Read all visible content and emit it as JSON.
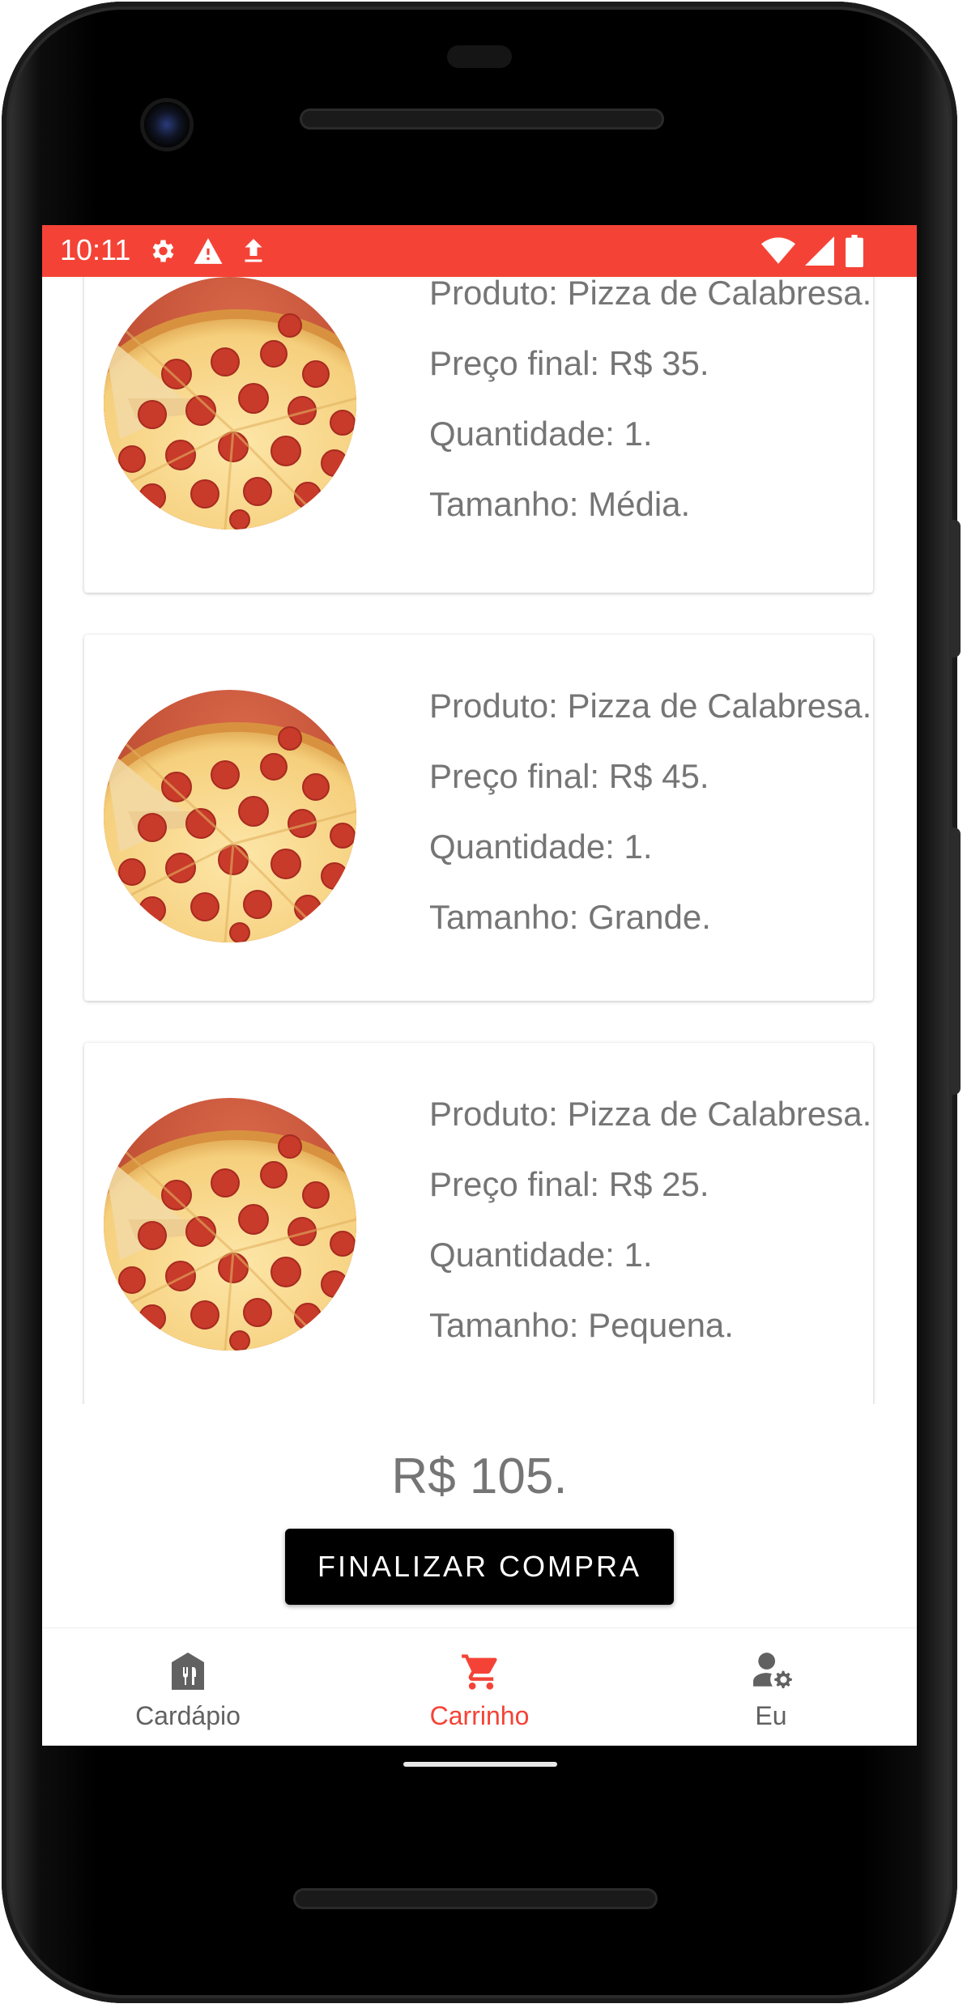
{
  "status_bar": {
    "time": "10:11",
    "icons_left": [
      "gear-icon",
      "warning-icon",
      "upload-icon"
    ],
    "icons_right": [
      "wifi-icon",
      "cell-signal-icon",
      "battery-icon"
    ],
    "color": "#f44336"
  },
  "cart": {
    "items": [
      {
        "product": "Produto: Pizza de Calabresa.",
        "price": "Preço final: R$ 35.",
        "quantity": "Quantidade: 1.",
        "size": "Tamanho: Média."
      },
      {
        "product": "Produto: Pizza de Calabresa.",
        "price": "Preço final: R$ 45.",
        "quantity": "Quantidade: 1.",
        "size": "Tamanho: Grande."
      },
      {
        "product": "Produto: Pizza de Calabresa.",
        "price": "Preço final: R$ 25.",
        "quantity": "Quantidade: 1.",
        "size": "Tamanho: Pequena."
      }
    ],
    "total": "R$ 105.",
    "checkout_label": "FINALIZAR COMPRA"
  },
  "bottom_nav": {
    "items": [
      {
        "label": "Cardápio",
        "icon": "menu-restaurant-icon",
        "active": false
      },
      {
        "label": "Carrinho",
        "icon": "cart-icon",
        "active": true
      },
      {
        "label": "Eu",
        "icon": "user-settings-icon",
        "active": false
      }
    ],
    "active_color": "#f44336",
    "inactive_color": "#616161"
  }
}
